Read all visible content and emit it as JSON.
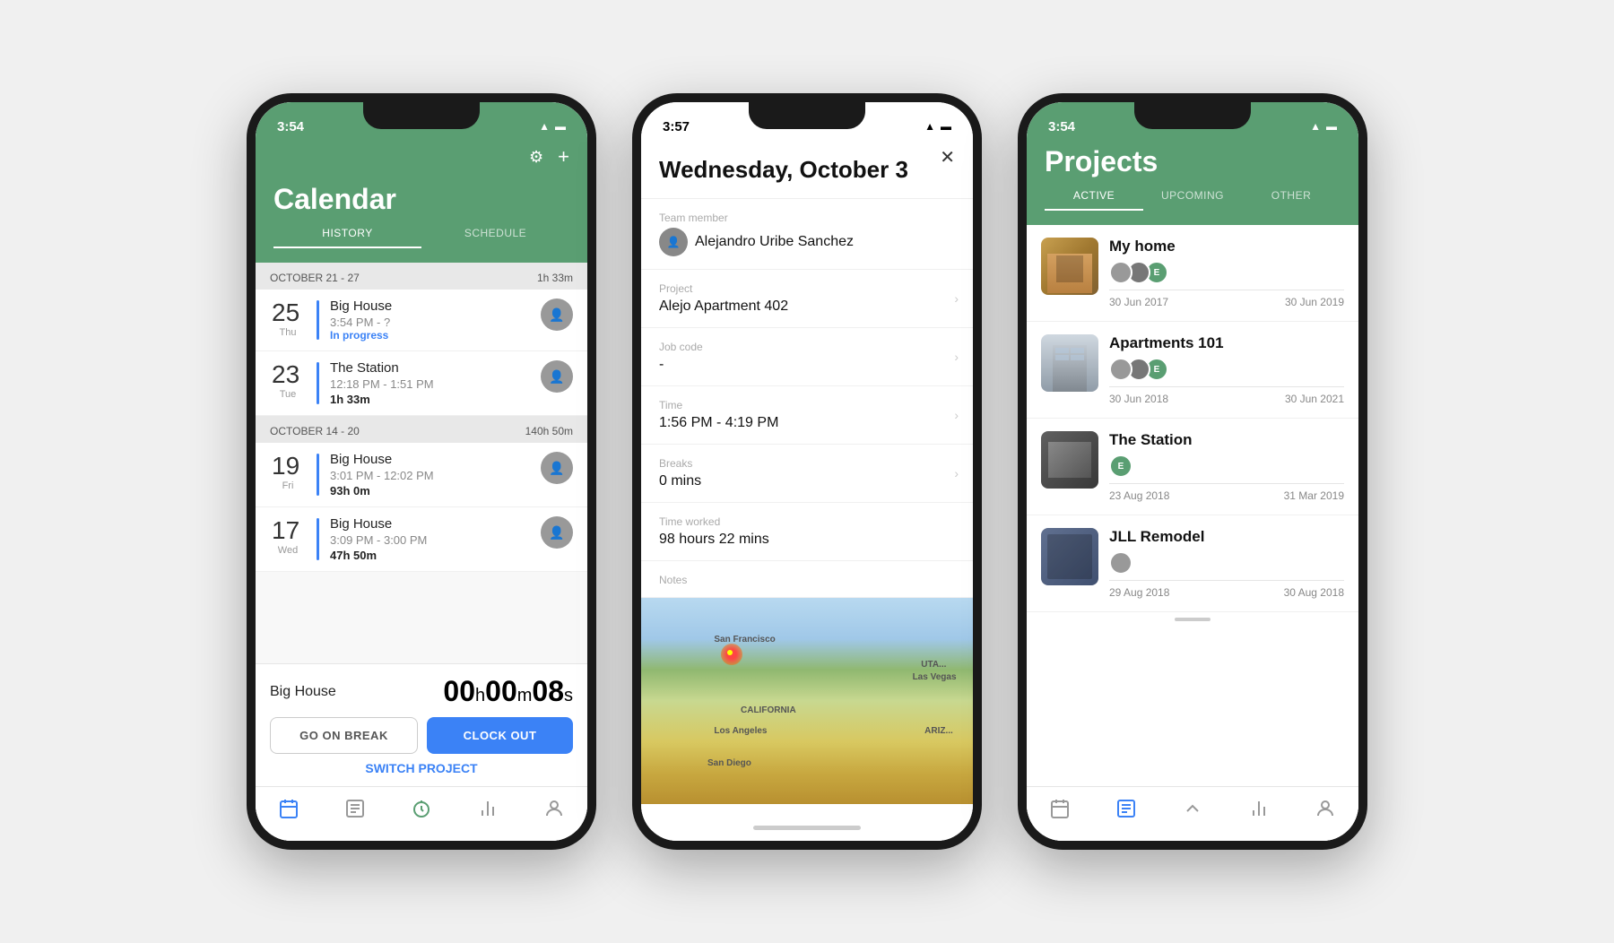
{
  "phone1": {
    "statusBar": {
      "time": "3:54",
      "location": true
    },
    "header": {
      "title": "Calendar",
      "filterIcon": "≡",
      "addIcon": "+"
    },
    "tabs": [
      {
        "label": "HISTORY",
        "active": true
      },
      {
        "label": "SCHEDULE",
        "active": false
      }
    ],
    "weeks": [
      {
        "label": "OCTOBER 21 - 27",
        "hours": "1h 33m",
        "days": [
          {
            "num": "25",
            "name": "Thu",
            "entries": [
              {
                "project": "Big House",
                "time": "3:54 PM - ?",
                "duration": "In progress",
                "durationStyle": "blue",
                "isProgress": true
              }
            ]
          },
          {
            "num": "23",
            "name": "Tue",
            "entries": [
              {
                "project": "The Station",
                "time": "12:18 PM - 1:51 PM",
                "duration": "1h 33m",
                "durationStyle": "bold",
                "isProgress": false
              }
            ]
          }
        ]
      },
      {
        "label": "OCTOBER 14 - 20",
        "hours": "140h 50m",
        "days": [
          {
            "num": "19",
            "name": "Fri",
            "entries": [
              {
                "project": "Big House",
                "time": "3:01 PM - 12:02 PM",
                "duration": "93h 0m",
                "durationStyle": "bold",
                "isProgress": false
              }
            ]
          },
          {
            "num": "17",
            "name": "Wed",
            "entries": [
              {
                "project": "Big House",
                "time": "3:09 PM - 3:00 PM",
                "duration": "47h 50m",
                "durationStyle": "bold",
                "isProgress": false
              }
            ]
          }
        ]
      }
    ],
    "clockBar": {
      "project": "Big House",
      "timer": "00h 00m 08s",
      "breakBtn": "GO ON BREAK",
      "clockoutBtn": "CLOCK OUT",
      "switchProject": "SWITCH PROJECT"
    },
    "tabBar": [
      "calendar",
      "list",
      "timer",
      "chart",
      "person"
    ]
  },
  "phone2": {
    "statusBar": {
      "time": "3:57"
    },
    "detail": {
      "date": "Wednesday, October 3",
      "fields": [
        {
          "label": "Team member",
          "value": "Alejandro Uribe Sanchez",
          "hasAvatar": true,
          "hasChevron": false
        },
        {
          "label": "Project",
          "value": "Alejo Apartment 402",
          "hasAvatar": false,
          "hasChevron": true
        },
        {
          "label": "Job code",
          "value": "-",
          "hasAvatar": false,
          "hasChevron": true
        },
        {
          "label": "Time",
          "value": "1:56 PM - 4:19 PM",
          "hasAvatar": false,
          "hasChevron": true
        },
        {
          "label": "Breaks",
          "value": "0 mins",
          "hasAvatar": false,
          "hasChevron": true
        },
        {
          "label": "Time worked",
          "value": "98 hours 22 mins",
          "hasAvatar": false,
          "hasChevron": false
        },
        {
          "label": "Notes",
          "value": "",
          "hasAvatar": false,
          "hasChevron": false
        }
      ]
    },
    "map": {
      "labels": [
        "San Francisco",
        "CALIFORNIA",
        "Las Vegas",
        "Los Angeles",
        "San Diego",
        "ARIZ...",
        "UTA..."
      ],
      "pinX": "28%",
      "pinY": "25%"
    }
  },
  "phone3": {
    "statusBar": {
      "time": "3:54"
    },
    "header": {
      "title": "Projects"
    },
    "tabs": [
      {
        "label": "ACTIVE",
        "active": true
      },
      {
        "label": "UPCOMING",
        "active": false
      },
      {
        "label": "OTHER",
        "active": false
      }
    ],
    "projects": [
      {
        "name": "My home",
        "startDate": "30 Jun 2017",
        "endDate": "30 Jun 2019",
        "thumbStyle": "building1",
        "avatarColors": [
          "#888",
          "#666",
          "#5a9e72"
        ]
      },
      {
        "name": "Apartments 101",
        "startDate": "30 Jun 2018",
        "endDate": "30 Jun 2021",
        "thumbStyle": "building2",
        "avatarColors": [
          "#888",
          "#666",
          "#5a9e72"
        ]
      },
      {
        "name": "The Station",
        "startDate": "23 Aug 2018",
        "endDate": "31 Mar 2019",
        "thumbStyle": "building3",
        "avatarColors": [
          "#5a9e72"
        ]
      },
      {
        "name": "JLL Remodel",
        "startDate": "29 Aug 2018",
        "endDate": "30 Aug 2018",
        "thumbStyle": "aerial",
        "avatarColors": [
          "#888"
        ]
      }
    ],
    "tabBar": [
      "calendar",
      "list",
      "chevron",
      "chart",
      "person"
    ]
  }
}
